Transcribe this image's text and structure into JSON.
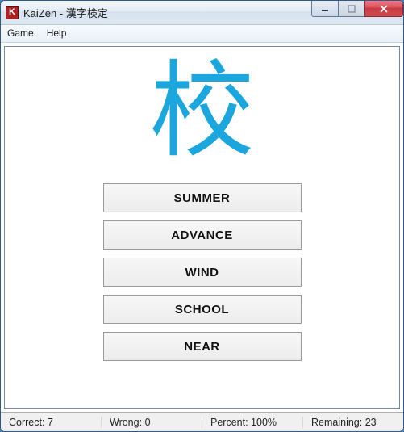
{
  "window": {
    "title": "KaiZen - 漢字検定",
    "icon_letter": "K"
  },
  "menubar": {
    "items": [
      "Game",
      "Help"
    ]
  },
  "quiz": {
    "kanji": "校",
    "answers": [
      "SUMMER",
      "ADVANCE",
      "WIND",
      "SCHOOL",
      "NEAR"
    ]
  },
  "status": {
    "correct_label": "Correct:",
    "correct_value": 7,
    "wrong_label": "Wrong:",
    "wrong_value": 0,
    "percent_label": "Percent:",
    "percent_value": "100%",
    "remaining_label": "Remaining:",
    "remaining_value": 23
  }
}
